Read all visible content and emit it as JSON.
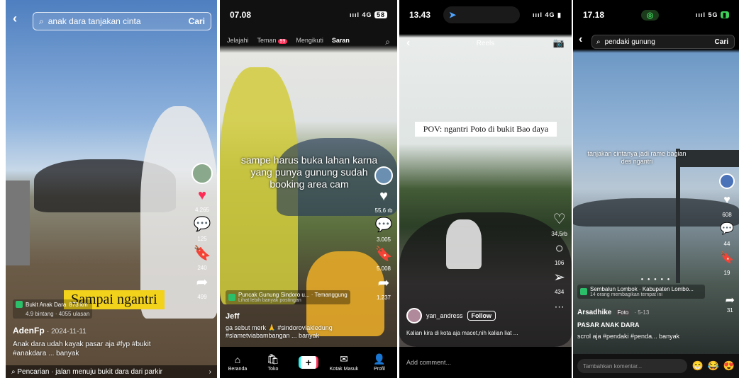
{
  "colors": {
    "like_red": "#fe2c55",
    "tiktok_cyan": "#25f4ee",
    "location_green": "#2bbf6a",
    "overlay_yellow": "#f2d21b"
  },
  "p1": {
    "search": {
      "query": "anak dara tanjakan cinta",
      "button": "Cari"
    },
    "overlay_text": "Sampai ngantri",
    "location": {
      "name": "Bukit Anak Dara",
      "distance": "873 km",
      "rating": "4.9 bintang · 4055 ulasan"
    },
    "likes": "4.265",
    "comments": "125",
    "saves": "240",
    "shares": "499",
    "username": "AdenFp",
    "date": "· 2024-11-11",
    "caption": "Anak dara udah kayak pasar aja #fyp #bukit #anakdara ... banyak",
    "related_search": "Pencarian · jalan menuju bukit dara dari parkir",
    "icons": [
      "back-arrow-icon",
      "search-icon",
      "heart-icon",
      "comment-icon",
      "bookmark-icon",
      "share-icon",
      "search-icon",
      "chevron-right-icon"
    ]
  },
  "p2": {
    "time": "07.08",
    "network": "4G",
    "battery": "58",
    "tabs": [
      "Jelajahi",
      "Teman",
      "Mengikuti",
      "Saran"
    ],
    "friends_badge": "99",
    "overlay_text": "sampe harus buka lahan karna yang punya gunung sudah booking area cam",
    "likes": "55,6 rb",
    "comments": "3.005",
    "saves": "5.008",
    "shares": "1.237",
    "location": {
      "name": "Puncak Gunung Sindoro u...",
      "region": "Temanggung",
      "sub": "Lihat lebih banyak postingan"
    },
    "username": "Jeff",
    "caption": "ga sebut merk 🙏 #sindoroviakledung #slametviabambangan ... banyak",
    "nav": [
      "Beranda",
      "Toko",
      "",
      "Kotak Masuk",
      "Profil"
    ],
    "icons": [
      "search-icon",
      "heart-icon",
      "comment-icon",
      "bookmark-icon",
      "share-icon",
      "home-icon",
      "shop-icon",
      "plus-icon",
      "inbox-icon",
      "profile-icon"
    ]
  },
  "p3": {
    "time": "13.43",
    "network": "4G",
    "header": "Reels",
    "overlay_text": "POV: ngantri Poto di bukit Bao daya",
    "likes": "34,5rb",
    "comments": "106",
    "shares": "434",
    "username": "yan_andress",
    "follow": "Follow",
    "caption": "Kalian kira di kota aja macet,nih kalian liat ...",
    "add_comment": "Add comment...",
    "icons": [
      "back-arrow-icon",
      "camera-icon",
      "heart-icon",
      "comment-icon",
      "send-icon",
      "more-icon"
    ]
  },
  "p4": {
    "time": "17.18",
    "network": "5G",
    "search": {
      "query": "pendaki gunung",
      "button": "Cari"
    },
    "overlay_text": "tanjakan cintanya jadi rame bagian des ngantri",
    "likes": "608",
    "comments": "44",
    "saves": "19",
    "shares": "31",
    "location": {
      "name": "Sembalun Lombok · Kabupaten Lombo...",
      "sub": "14 orang membagikan tempat ini"
    },
    "username": "Arsadhike",
    "tag": "Foto",
    "date": "· 5-13",
    "title": "PASAR ANAK DARA",
    "caption": "scrol aja #pendaki #penda... banyak",
    "comment_placeholder": "Tambahkan komentar...",
    "emojis": [
      "😁",
      "😂",
      "😍"
    ],
    "icons": [
      "back-arrow-icon",
      "search-icon",
      "heart-icon",
      "comment-icon",
      "bookmark-icon",
      "share-icon"
    ]
  }
}
